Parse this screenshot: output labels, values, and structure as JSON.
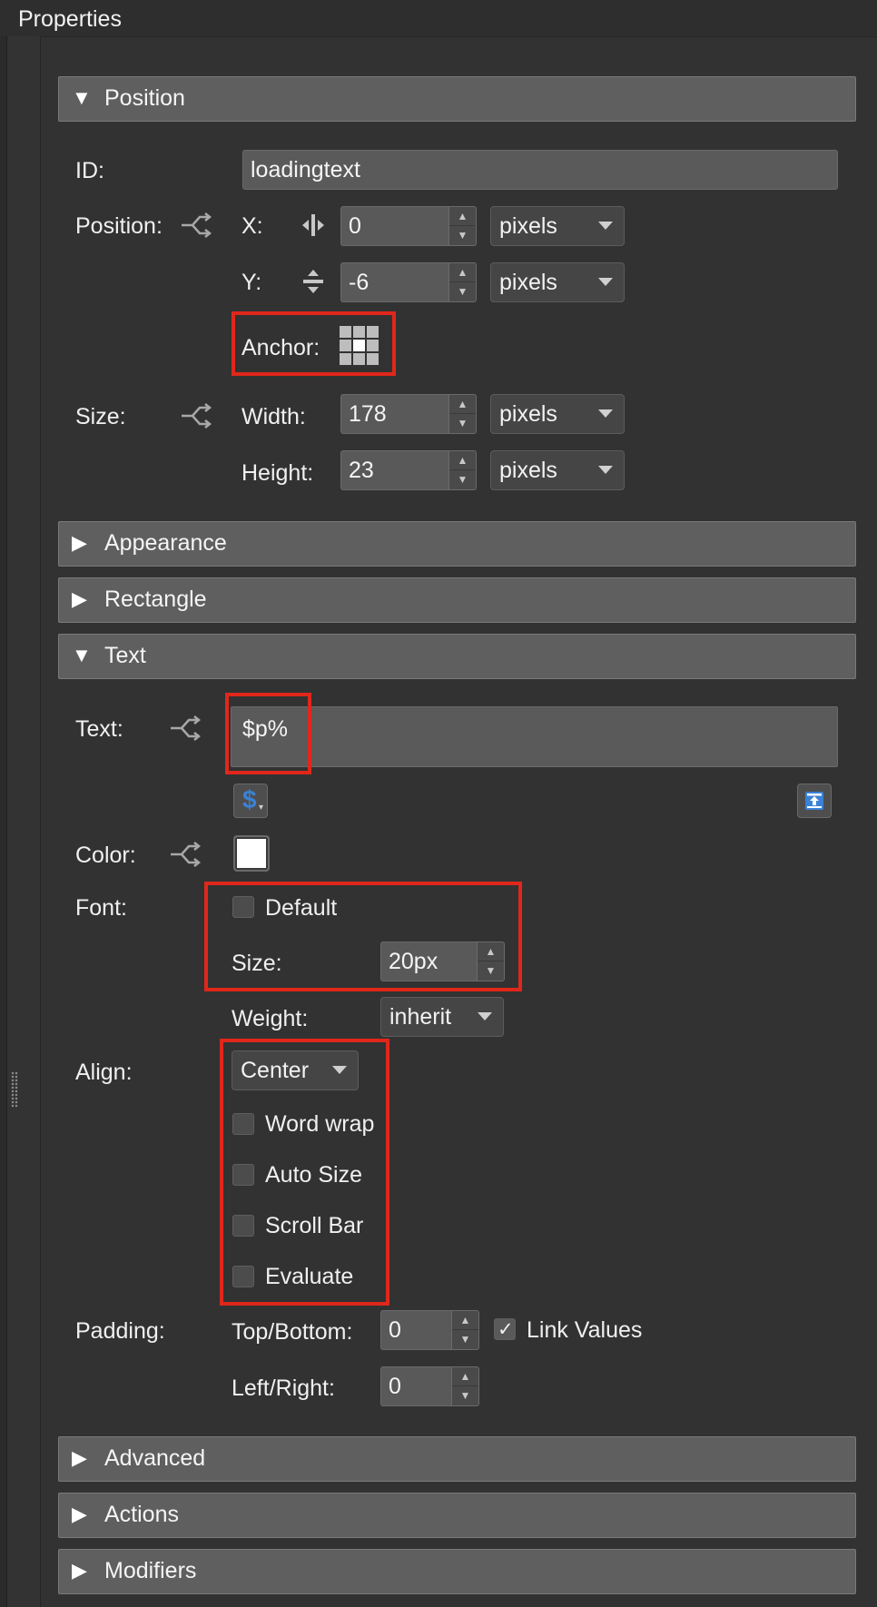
{
  "panel": {
    "title": "Properties"
  },
  "sections": {
    "position": "Position",
    "appearance": "Appearance",
    "rectangle": "Rectangle",
    "text": "Text",
    "advanced": "Advanced",
    "actions": "Actions",
    "modifiers": "Modifiers"
  },
  "position": {
    "id_label": "ID:",
    "id_value": "loadingtext",
    "position_label": "Position:",
    "x_label": "X:",
    "x_value": "0",
    "x_unit": "pixels",
    "y_label": "Y:",
    "y_value": "-6",
    "y_unit": "pixels",
    "anchor_label": "Anchor:",
    "size_label": "Size:",
    "width_label": "Width:",
    "width_value": "178",
    "width_unit": "pixels",
    "height_label": "Height:",
    "height_value": "23",
    "height_unit": "pixels"
  },
  "text": {
    "text_label": "Text:",
    "text_value": "$p%",
    "variable_button": "$",
    "color_label": "Color:",
    "color_value": "#ffffff",
    "font_label": "Font:",
    "default_label": "Default",
    "size_label": "Size:",
    "size_value": "20px",
    "weight_label": "Weight:",
    "weight_value": "inherit",
    "align_label": "Align:",
    "align_value": "Center",
    "word_wrap": "Word wrap",
    "auto_size": "Auto Size",
    "scroll_bar": "Scroll Bar",
    "evaluate": "Evaluate",
    "padding_label": "Padding:",
    "top_bottom_label": "Top/Bottom:",
    "top_bottom_value": "0",
    "link_values": "Link Values",
    "left_right_label": "Left/Right:",
    "left_right_value": "0"
  },
  "colors": {
    "highlight": "#e0271b",
    "background": "#333333",
    "section_header": "#5f5f5f",
    "accent_blue": "#3a82d6"
  }
}
